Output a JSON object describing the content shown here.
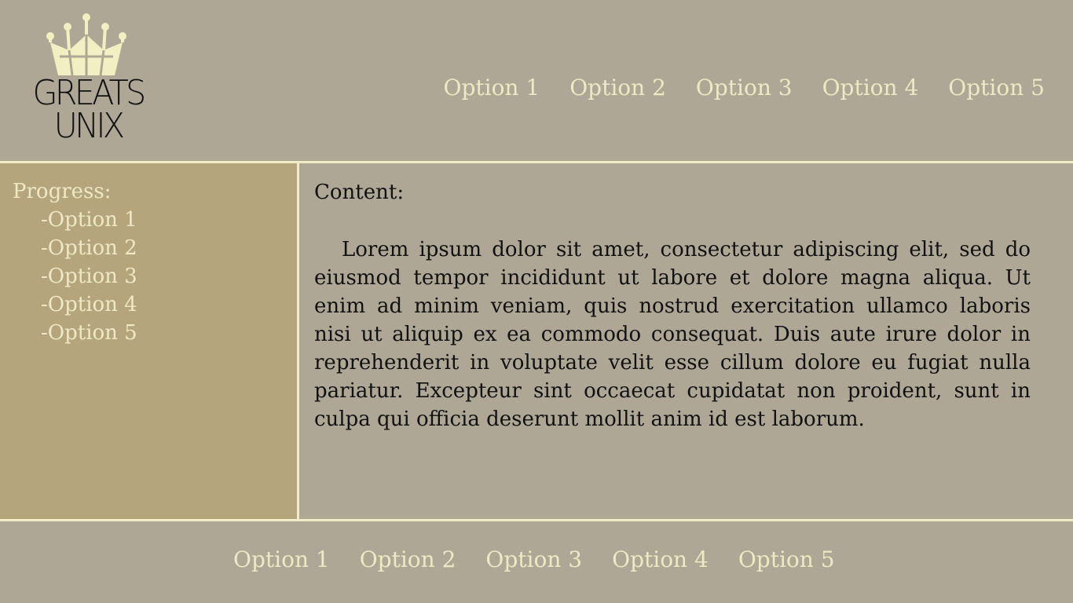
{
  "brand": {
    "line1": "GREATS",
    "line2": "UNIX"
  },
  "topnav": {
    "items": [
      "Option 1",
      "Option 2",
      "Option 3",
      "Option 4",
      "Option 5"
    ]
  },
  "sidebar": {
    "title": "Progress:",
    "items": [
      "-Option 1",
      "-Option 2",
      "-Option 3",
      "-Option 4",
      "-Option 5"
    ]
  },
  "content": {
    "title": "Content:",
    "body": "Lorem ipsum dolor sit amet, consectetur adipiscing elit, sed do eiusmod tempor incididunt ut labore et dolore magna aliqua. Ut enim ad minim veniam, quis nostrud exercitation ullamco laboris nisi ut aliquip ex ea commodo consequat. Duis aute irure dolor in reprehenderit in voluptate velit esse cillum dolore eu fugiat nulla pariatur. Excepteur sint occaecat cupidatat non proident, sunt in culpa qui officia deserunt mollit anim id est laborum."
  },
  "footer": {
    "items": [
      "Option 1",
      "Option 2",
      "Option 3",
      "Option 4",
      "Option 5"
    ]
  },
  "colors": {
    "background": "#aea796",
    "sidebar": "#b4a57d",
    "accent_text": "#eee8c4",
    "divider": "#f1ebc7",
    "body_text": "#111111"
  }
}
